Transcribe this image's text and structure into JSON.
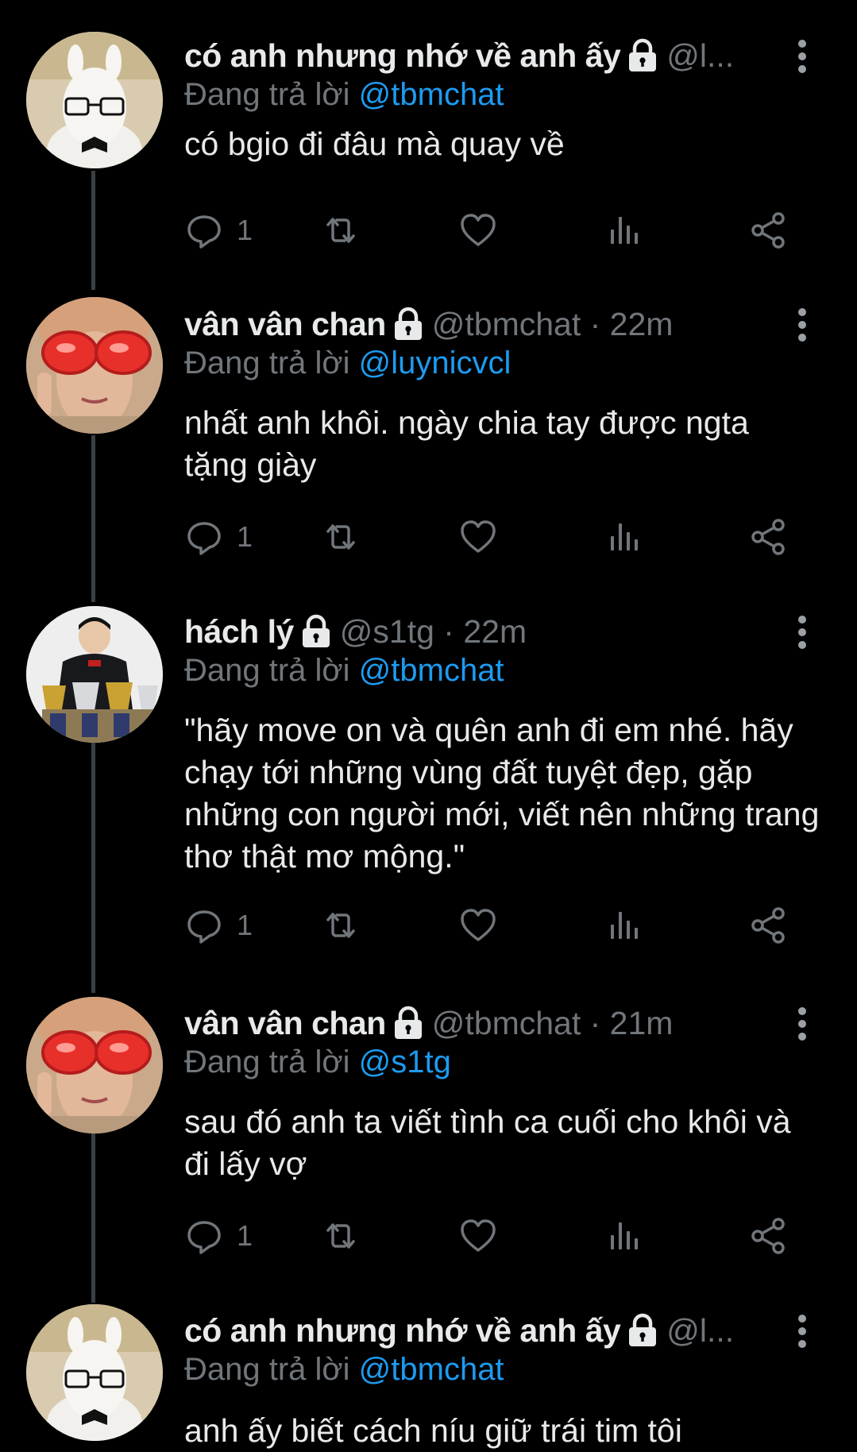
{
  "colors": {
    "background": "#000000",
    "text": "#e7e9ea",
    "muted": "#71767b",
    "link": "#1d9bf0",
    "thread_line": "#3a3f44"
  },
  "icons": {
    "lock": "lock-icon",
    "more": "more-vertical-icon",
    "reply": "reply-icon",
    "retweet": "retweet-icon",
    "like": "heart-icon",
    "views": "views-icon",
    "share": "share-icon"
  },
  "tweets": [
    {
      "name": "có anh nhưng nhớ về anh ấy",
      "handle": "@l...",
      "reply_prefix": "Đang trả lời ",
      "reply_to": "@tbmchat",
      "text": "có bgio đi đâu mà quay về",
      "reply_count": "1",
      "avatar": "alpaca-avatar"
    },
    {
      "name": "vân vân chan",
      "handle": "@tbmchat · 22m",
      "reply_prefix": "Đang trả lời ",
      "reply_to": "@luynicvcl",
      "text": "nhất anh khôi. ngày chia tay được ngta tặng giày",
      "reply_count": "1",
      "avatar": "red-glasses-avatar"
    },
    {
      "name": "hách lý",
      "handle": "@s1tg · 22m",
      "reply_prefix": "Đang trả lời ",
      "reply_to": "@tbmchat",
      "text": "\"hãy move on và quên anh đi em nhé. hãy chạy tới những vùng đất tuyệt đẹp, gặp những con người mới, viết nên những trang thơ thật mơ mộng.\"",
      "reply_count": "1",
      "avatar": "trophies-avatar"
    },
    {
      "name": "vân vân chan",
      "handle": "@tbmchat · 21m",
      "reply_prefix": "Đang trả lời ",
      "reply_to": "@s1tg",
      "text": "sau đó anh ta viết tình ca cuối cho khôi và đi lấy vợ",
      "reply_count": "1",
      "avatar": "red-glasses-avatar"
    },
    {
      "name": "có anh nhưng nhớ về anh ấy",
      "handle": "@l...",
      "reply_prefix": "Đang trả lời ",
      "reply_to": "@tbmchat",
      "text": "anh ấy biết cách níu giữ trái tim tôi",
      "reply_count": "",
      "avatar": "alpaca-avatar"
    }
  ]
}
